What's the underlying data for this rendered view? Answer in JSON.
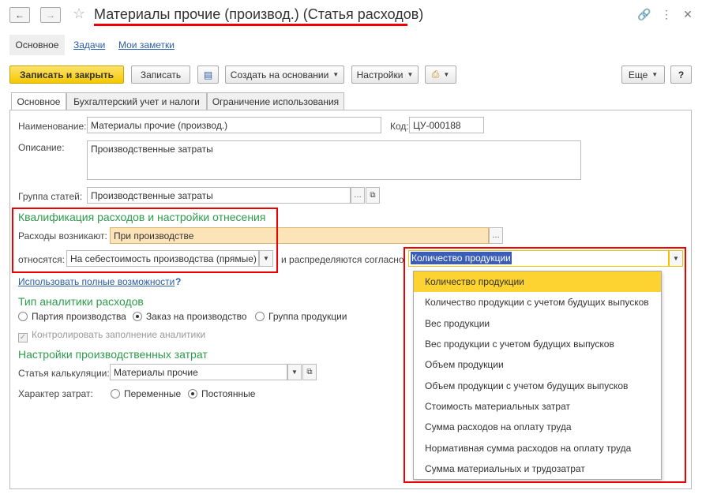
{
  "window": {
    "title": "Материалы прочие (производ.) (Статья расходов)"
  },
  "nav": {
    "active": "Основное",
    "links": [
      "Задачи",
      "Мои заметки"
    ]
  },
  "toolbar": {
    "save_close": "Записать и закрыть",
    "save": "Записать",
    "create_based": "Создать на основании",
    "settings": "Настройки",
    "more": "Еще",
    "help": "?"
  },
  "tabs": [
    "Основное",
    "Бухгалтерский учет и налоги",
    "Ограничение использования"
  ],
  "form": {
    "name_label": "Наименование:",
    "name_value": "Материалы прочие (производ.)",
    "code_label": "Код:",
    "code_value": "ЦУ-000188",
    "desc_label": "Описание:",
    "desc_value": "Производственные затраты",
    "group_label": "Группа статей:",
    "group_value": "Производственные затраты"
  },
  "qualification": {
    "title": "Квалификация расходов и настройки отнесения",
    "arise_label": "Расходы возникают:",
    "arise_value": "При производстве",
    "relate_label": "относятся:",
    "relate_value": "На себестоимость производства (прямые)",
    "distribute_label": "и распределяются согласно",
    "distribute_value": "Количество продукции",
    "full_link": "Использовать полные возможности",
    "help": "?"
  },
  "analytics": {
    "title": "Тип аналитики расходов",
    "options": [
      "Партия производства",
      "Заказ на производство",
      "Группа продукции"
    ],
    "selected": 1,
    "control_label": "Контролировать заполнение аналитики"
  },
  "production": {
    "title": "Настройки производственных затрат",
    "calc_label": "Статья калькуляции:",
    "calc_value": "Материалы прочие",
    "nature_label": "Характер затрат:",
    "nature_options": [
      "Переменные",
      "Постоянные"
    ],
    "nature_selected": 1
  },
  "dropdown": {
    "items": [
      "Количество продукции",
      "Количество продукции с учетом будущих выпусков",
      "Вес продукции",
      "Вес продукции с учетом будущих выпусков",
      "Объем продукции",
      "Объем продукции с учетом будущих выпусков",
      "Стоимость материальных затрат",
      "Сумма расходов на оплату труда",
      "Нормативная сумма расходов на оплату труда",
      "Сумма материальных и трудозатрат"
    ],
    "selected": 0
  },
  "colors": {
    "accent_green": "#2e9b4b",
    "highlight_red": "#e00000",
    "selection_yellow": "#fcd330",
    "link_blue": "#2a5ea8"
  }
}
